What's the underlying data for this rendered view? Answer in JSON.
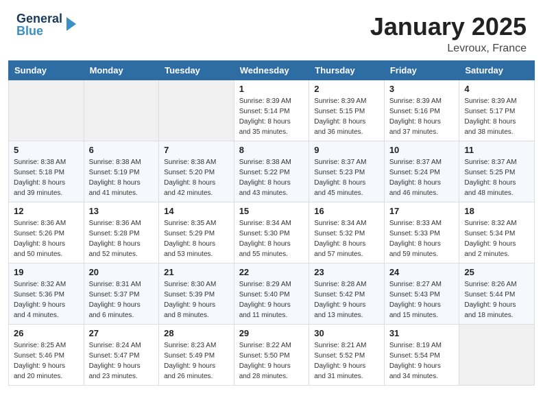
{
  "header": {
    "logo_general": "General",
    "logo_blue": "Blue",
    "title": "January 2025",
    "subtitle": "Levroux, France"
  },
  "weekdays": [
    "Sunday",
    "Monday",
    "Tuesday",
    "Wednesday",
    "Thursday",
    "Friday",
    "Saturday"
  ],
  "weeks": [
    [
      {
        "day": "",
        "info": ""
      },
      {
        "day": "",
        "info": ""
      },
      {
        "day": "",
        "info": ""
      },
      {
        "day": "1",
        "info": "Sunrise: 8:39 AM\nSunset: 5:14 PM\nDaylight: 8 hours\nand 35 minutes."
      },
      {
        "day": "2",
        "info": "Sunrise: 8:39 AM\nSunset: 5:15 PM\nDaylight: 8 hours\nand 36 minutes."
      },
      {
        "day": "3",
        "info": "Sunrise: 8:39 AM\nSunset: 5:16 PM\nDaylight: 8 hours\nand 37 minutes."
      },
      {
        "day": "4",
        "info": "Sunrise: 8:39 AM\nSunset: 5:17 PM\nDaylight: 8 hours\nand 38 minutes."
      }
    ],
    [
      {
        "day": "5",
        "info": "Sunrise: 8:38 AM\nSunset: 5:18 PM\nDaylight: 8 hours\nand 39 minutes."
      },
      {
        "day": "6",
        "info": "Sunrise: 8:38 AM\nSunset: 5:19 PM\nDaylight: 8 hours\nand 41 minutes."
      },
      {
        "day": "7",
        "info": "Sunrise: 8:38 AM\nSunset: 5:20 PM\nDaylight: 8 hours\nand 42 minutes."
      },
      {
        "day": "8",
        "info": "Sunrise: 8:38 AM\nSunset: 5:22 PM\nDaylight: 8 hours\nand 43 minutes."
      },
      {
        "day": "9",
        "info": "Sunrise: 8:37 AM\nSunset: 5:23 PM\nDaylight: 8 hours\nand 45 minutes."
      },
      {
        "day": "10",
        "info": "Sunrise: 8:37 AM\nSunset: 5:24 PM\nDaylight: 8 hours\nand 46 minutes."
      },
      {
        "day": "11",
        "info": "Sunrise: 8:37 AM\nSunset: 5:25 PM\nDaylight: 8 hours\nand 48 minutes."
      }
    ],
    [
      {
        "day": "12",
        "info": "Sunrise: 8:36 AM\nSunset: 5:26 PM\nDaylight: 8 hours\nand 50 minutes."
      },
      {
        "day": "13",
        "info": "Sunrise: 8:36 AM\nSunset: 5:28 PM\nDaylight: 8 hours\nand 52 minutes."
      },
      {
        "day": "14",
        "info": "Sunrise: 8:35 AM\nSunset: 5:29 PM\nDaylight: 8 hours\nand 53 minutes."
      },
      {
        "day": "15",
        "info": "Sunrise: 8:34 AM\nSunset: 5:30 PM\nDaylight: 8 hours\nand 55 minutes."
      },
      {
        "day": "16",
        "info": "Sunrise: 8:34 AM\nSunset: 5:32 PM\nDaylight: 8 hours\nand 57 minutes."
      },
      {
        "day": "17",
        "info": "Sunrise: 8:33 AM\nSunset: 5:33 PM\nDaylight: 8 hours\nand 59 minutes."
      },
      {
        "day": "18",
        "info": "Sunrise: 8:32 AM\nSunset: 5:34 PM\nDaylight: 9 hours\nand 2 minutes."
      }
    ],
    [
      {
        "day": "19",
        "info": "Sunrise: 8:32 AM\nSunset: 5:36 PM\nDaylight: 9 hours\nand 4 minutes."
      },
      {
        "day": "20",
        "info": "Sunrise: 8:31 AM\nSunset: 5:37 PM\nDaylight: 9 hours\nand 6 minutes."
      },
      {
        "day": "21",
        "info": "Sunrise: 8:30 AM\nSunset: 5:39 PM\nDaylight: 9 hours\nand 8 minutes."
      },
      {
        "day": "22",
        "info": "Sunrise: 8:29 AM\nSunset: 5:40 PM\nDaylight: 9 hours\nand 11 minutes."
      },
      {
        "day": "23",
        "info": "Sunrise: 8:28 AM\nSunset: 5:42 PM\nDaylight: 9 hours\nand 13 minutes."
      },
      {
        "day": "24",
        "info": "Sunrise: 8:27 AM\nSunset: 5:43 PM\nDaylight: 9 hours\nand 15 minutes."
      },
      {
        "day": "25",
        "info": "Sunrise: 8:26 AM\nSunset: 5:44 PM\nDaylight: 9 hours\nand 18 minutes."
      }
    ],
    [
      {
        "day": "26",
        "info": "Sunrise: 8:25 AM\nSunset: 5:46 PM\nDaylight: 9 hours\nand 20 minutes."
      },
      {
        "day": "27",
        "info": "Sunrise: 8:24 AM\nSunset: 5:47 PM\nDaylight: 9 hours\nand 23 minutes."
      },
      {
        "day": "28",
        "info": "Sunrise: 8:23 AM\nSunset: 5:49 PM\nDaylight: 9 hours\nand 26 minutes."
      },
      {
        "day": "29",
        "info": "Sunrise: 8:22 AM\nSunset: 5:50 PM\nDaylight: 9 hours\nand 28 minutes."
      },
      {
        "day": "30",
        "info": "Sunrise: 8:21 AM\nSunset: 5:52 PM\nDaylight: 9 hours\nand 31 minutes."
      },
      {
        "day": "31",
        "info": "Sunrise: 8:19 AM\nSunset: 5:54 PM\nDaylight: 9 hours\nand 34 minutes."
      },
      {
        "day": "",
        "info": ""
      }
    ]
  ]
}
